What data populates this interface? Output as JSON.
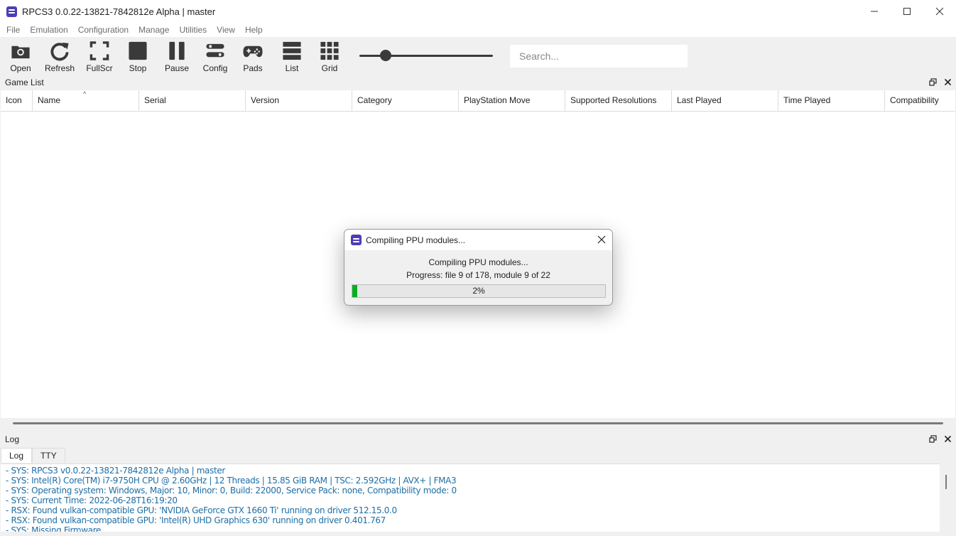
{
  "window": {
    "title": "RPCS3 0.0.22-13821-7842812e Alpha | master"
  },
  "menu": [
    "File",
    "Emulation",
    "Configuration",
    "Manage",
    "Utilities",
    "View",
    "Help"
  ],
  "toolbar": {
    "buttons": [
      {
        "label": "Open",
        "icon": "folder-camera-icon"
      },
      {
        "label": "Refresh",
        "icon": "refresh-icon"
      },
      {
        "label": "FullScr",
        "icon": "fullscreen-icon"
      },
      {
        "label": "Stop",
        "icon": "stop-icon"
      },
      {
        "label": "Pause",
        "icon": "pause-icon"
      },
      {
        "label": "Config",
        "icon": "config-icon"
      },
      {
        "label": "Pads",
        "icon": "gamepad-icon"
      },
      {
        "label": "List",
        "icon": "list-icon"
      },
      {
        "label": "Grid",
        "icon": "grid-icon"
      }
    ],
    "icon_size_slider_value": 0.17,
    "search_placeholder": "Search..."
  },
  "game_list": {
    "title": "Game List",
    "columns": [
      "Icon",
      "Name",
      "Serial",
      "Version",
      "Category",
      "PlayStation Move",
      "Supported Resolutions",
      "Last Played",
      "Time Played",
      "Compatibility"
    ],
    "sorted_column": "Name",
    "rows": []
  },
  "dialog": {
    "title": "Compiling PPU modules...",
    "message": "Compiling PPU modules...",
    "progress_text": "Progress: file 9 of 178, module 9 of 22",
    "progress_label": "2%",
    "progress_value": 0.02,
    "progress_color": "#06b025"
  },
  "log": {
    "title": "Log",
    "tabs": [
      "Log",
      "TTY"
    ],
    "active_tab": "Log",
    "lines": [
      "- SYS: RPCS3 v0.0.22-13821-7842812e Alpha | master",
      "- SYS: Intel(R) Core(TM) i7-9750H CPU @ 2.60GHz | 12 Threads | 15.85 GiB RAM | TSC: 2.592GHz | AVX+ | FMA3",
      "- SYS: Operating system: Windows, Major: 10, Minor: 0, Build: 22000, Service Pack: none, Compatibility mode: 0",
      "- SYS: Current Time: 2022-06-28T16:19:20",
      "- RSX: Found vulkan-compatible GPU: 'NVIDIA GeForce GTX 1660 Ti' running on driver 512.15.0.0",
      "- RSX: Found vulkan-compatible GPU: 'Intel(R) UHD Graphics 630' running on driver 0.401.767",
      "- SYS: Missing Firmware"
    ],
    "text_color": "#1e6ea5"
  },
  "colors": {
    "app_icon": "#4b3db6",
    "toolbar_icon": "#3a3a3a"
  }
}
